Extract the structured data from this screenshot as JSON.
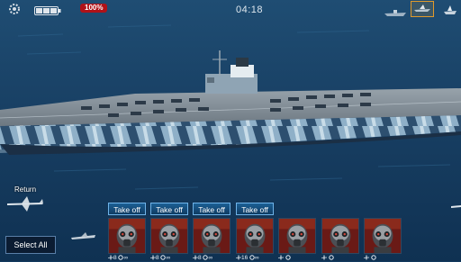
{
  "hud": {
    "health_badge": "100%",
    "timer": "04:18",
    "icons": [
      "gear-icon",
      "battery-icon",
      "ship-icon",
      "view-toggle-icon",
      "fleet-icon"
    ]
  },
  "return": {
    "label": "Return"
  },
  "actions": {
    "select_all": "Select All"
  },
  "squadrons": [
    {
      "takeoff_label": "Take off",
      "stat_a": "8",
      "stat_b": "∞"
    },
    {
      "takeoff_label": "Take off",
      "stat_a": "8",
      "stat_b": "∞"
    },
    {
      "takeoff_label": "Take off",
      "stat_a": "8",
      "stat_b": "∞"
    },
    {
      "takeoff_label": "Take off",
      "stat_a": "16",
      "stat_b": "∞"
    },
    {
      "takeoff_label": "",
      "stat_a": "",
      "stat_b": ""
    },
    {
      "takeoff_label": "",
      "stat_a": "",
      "stat_b": ""
    },
    {
      "takeoff_label": "",
      "stat_a": "",
      "stat_b": ""
    }
  ],
  "colors": {
    "ocean": "#123a5e",
    "hull_camo_light": "#8fb0c8",
    "hull_camo_dark": "#2d4f6f",
    "deck": "#7e8a94",
    "badge_red": "#b01218",
    "button_blue": "#1c5f95",
    "highlight_orange": "#e09a2b"
  }
}
